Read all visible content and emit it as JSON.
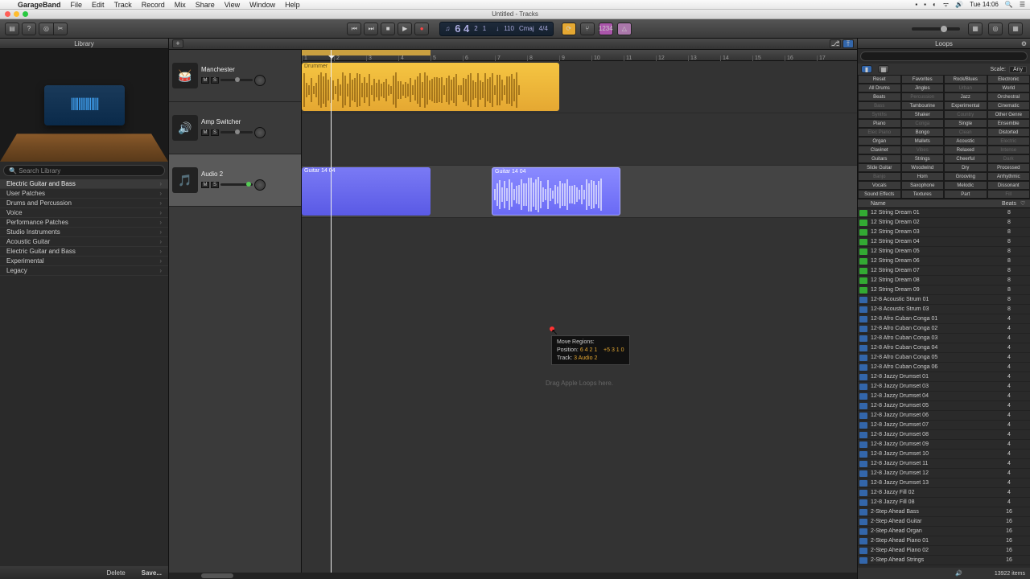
{
  "menu": {
    "app": "GarageBand",
    "items": [
      "File",
      "Edit",
      "Track",
      "Record",
      "Mix",
      "Share",
      "View",
      "Window",
      "Help"
    ],
    "clock": "Tue 14:06"
  },
  "window": {
    "title": "Untitled - Tracks"
  },
  "lcd": {
    "bars": "6 4",
    "beats": "2",
    "sub": "1",
    "tempo": "110",
    "key": "Cmaj",
    "sig": "4/4"
  },
  "library": {
    "title": "Library",
    "search_placeholder": "Search Library",
    "header_cat": "Electric Guitar and Bass",
    "cats": [
      "User Patches",
      "Drums and Percussion",
      "Voice",
      "Performance Patches",
      "Studio Instruments",
      "Acoustic Guitar",
      "Electric Guitar and Bass",
      "Experimental",
      "Legacy"
    ],
    "delete": "Delete",
    "save": "Save..."
  },
  "tracks": [
    {
      "name": "Manchester",
      "icon": "🥁",
      "selected": false
    },
    {
      "name": "Amp Switcher",
      "icon": "🔊",
      "selected": false
    },
    {
      "name": "Audio 2",
      "icon": "🎵",
      "selected": true
    }
  ],
  "regions": {
    "drummer": "Drummer",
    "g1": "Guitar 14 04",
    "g2": "Guitar 14 04"
  },
  "ruler_marks": [
    1,
    2,
    3,
    4,
    5,
    6,
    7,
    8,
    9,
    10,
    11,
    12,
    13,
    14,
    15,
    16,
    17
  ],
  "tooltip": {
    "title": "Move Regions:",
    "pos_label": "Position:",
    "pos": "6 4 2 1",
    "delta": "+5 3 1 0",
    "track_label": "Track:",
    "track": "3  Audio 2"
  },
  "drop_hint": "Drag Apple Loops here.",
  "loops": {
    "title": "Loops",
    "scale_label": "Scale:",
    "scale_value": "Any",
    "reset": "Reset",
    "favorites": "Favorites",
    "filter_rows": [
      [
        "Reset",
        "Favorites",
        "Rock/Blues",
        "Electronic"
      ],
      [
        "All Drums",
        "Jingles",
        "Urban",
        "World"
      ],
      [
        "Beats",
        "Percussion",
        "Jazz",
        "Orchestral"
      ],
      [
        "Bass",
        "Tambourine",
        "Experimental",
        "Cinematic"
      ],
      [
        "Synths",
        "Shaker",
        "Country",
        "Other Genre"
      ],
      [
        "Piano",
        "Conga",
        "Single",
        "Ensemble"
      ],
      [
        "Elec Piano",
        "Bongo",
        "Clean",
        "Distorted"
      ],
      [
        "Organ",
        "Mallets",
        "Acoustic",
        "Electric"
      ],
      [
        "Clavinet",
        "Vibes",
        "Relaxed",
        "Intense"
      ],
      [
        "Guitars",
        "Strings",
        "Cheerful",
        "Dark"
      ],
      [
        "Slide Guitar",
        "Woodwind",
        "Dry",
        "Processed"
      ],
      [
        "Banjo",
        "Horn",
        "Grooving",
        "Arrhythmic"
      ],
      [
        "Vocals",
        "Saxophone",
        "Melodic",
        "Dissonant"
      ],
      [
        "Sound Effects",
        "Textures",
        "Part",
        "Fill"
      ]
    ],
    "columns": {
      "name": "Name",
      "beats": "Beats"
    },
    "items": [
      {
        "ic": "g",
        "n": "12 String Dream 01",
        "b": 8
      },
      {
        "ic": "g",
        "n": "12 String Dream 02",
        "b": 8
      },
      {
        "ic": "g",
        "n": "12 String Dream 03",
        "b": 8
      },
      {
        "ic": "g",
        "n": "12 String Dream 04",
        "b": 8
      },
      {
        "ic": "g",
        "n": "12 String Dream 05",
        "b": 8
      },
      {
        "ic": "g",
        "n": "12 String Dream 06",
        "b": 8
      },
      {
        "ic": "g",
        "n": "12 String Dream 07",
        "b": 8
      },
      {
        "ic": "g",
        "n": "12 String Dream 08",
        "b": 8
      },
      {
        "ic": "g",
        "n": "12 String Dream 09",
        "b": 8
      },
      {
        "ic": "b",
        "n": "12-8 Acoustic Strum 01",
        "b": 8
      },
      {
        "ic": "b",
        "n": "12-8 Acoustic Strum 03",
        "b": 8
      },
      {
        "ic": "b",
        "n": "12-8 Afro Cuban Conga 01",
        "b": 4
      },
      {
        "ic": "b",
        "n": "12-8 Afro Cuban Conga 02",
        "b": 4
      },
      {
        "ic": "b",
        "n": "12-8 Afro Cuban Conga 03",
        "b": 4
      },
      {
        "ic": "b",
        "n": "12-8 Afro Cuban Conga 04",
        "b": 4
      },
      {
        "ic": "b",
        "n": "12-8 Afro Cuban Conga 05",
        "b": 4
      },
      {
        "ic": "b",
        "n": "12-8 Afro Cuban Conga 06",
        "b": 4
      },
      {
        "ic": "b",
        "n": "12-8 Jazzy Drumset 01",
        "b": 4
      },
      {
        "ic": "b",
        "n": "12-8 Jazzy Drumset 03",
        "b": 4
      },
      {
        "ic": "b",
        "n": "12-8 Jazzy Drumset 04",
        "b": 4
      },
      {
        "ic": "b",
        "n": "12-8 Jazzy Drumset 05",
        "b": 4
      },
      {
        "ic": "b",
        "n": "12-8 Jazzy Drumset 06",
        "b": 4
      },
      {
        "ic": "b",
        "n": "12-8 Jazzy Drumset 07",
        "b": 4
      },
      {
        "ic": "b",
        "n": "12-8 Jazzy Drumset 08",
        "b": 4
      },
      {
        "ic": "b",
        "n": "12-8 Jazzy Drumset 09",
        "b": 4
      },
      {
        "ic": "b",
        "n": "12-8 Jazzy Drumset 10",
        "b": 4
      },
      {
        "ic": "b",
        "n": "12-8 Jazzy Drumset 11",
        "b": 4
      },
      {
        "ic": "b",
        "n": "12-8 Jazzy Drumset 12",
        "b": 4
      },
      {
        "ic": "b",
        "n": "12-8 Jazzy Drumset 13",
        "b": 4
      },
      {
        "ic": "b",
        "n": "12-8 Jazzy Fill 02",
        "b": 4
      },
      {
        "ic": "b",
        "n": "12-8 Jazzy Fill 08",
        "b": 4
      },
      {
        "ic": "b",
        "n": "2-Step Ahead Bass",
        "b": 16
      },
      {
        "ic": "b",
        "n": "2-Step Ahead Guitar",
        "b": 16
      },
      {
        "ic": "b",
        "n": "2-Step Ahead Organ",
        "b": 16
      },
      {
        "ic": "b",
        "n": "2-Step Ahead Piano 01",
        "b": 16
      },
      {
        "ic": "b",
        "n": "2-Step Ahead Piano 02",
        "b": 16
      },
      {
        "ic": "b",
        "n": "2-Step Ahead Strings",
        "b": 16
      }
    ],
    "footer_count": "13922 items"
  }
}
